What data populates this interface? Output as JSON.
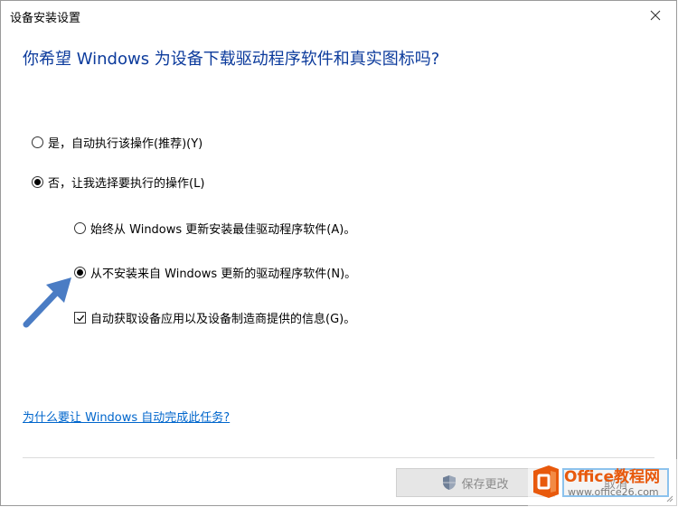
{
  "window": {
    "title": "设备安装设置"
  },
  "heading": "你希望 Windows 为设备下载驱动程序软件和真实图标吗?",
  "options": {
    "yes": {
      "label": "是，自动执行该操作(推荐)(Y)",
      "selected": false
    },
    "no": {
      "label": "否，让我选择要执行的操作(L)",
      "selected": true
    },
    "always": {
      "label": "始终从 Windows 更新安装最佳驱动程序软件(A)。",
      "selected": false
    },
    "never": {
      "label": "从不安装来自 Windows 更新的驱动程序软件(N)。",
      "selected": true
    },
    "auto_info": {
      "label": "自动获取设备应用以及设备制造商提供的信息(G)。",
      "checked": true
    }
  },
  "link": "为什么要让 Windows 自动完成此任务?",
  "buttons": {
    "save_label": "保存更改",
    "cancel_label": "取消"
  },
  "watermark": {
    "brand": "Office教程网",
    "url": "www.office26.com"
  },
  "colors": {
    "heading": "#0c3b9c",
    "link": "#0066cc",
    "accent_border": "#0078d7",
    "arrow": "#4a7cc4",
    "watermark_orange": "#e8590c"
  },
  "icons": {
    "close": "close-icon",
    "shield": "uac-shield-icon",
    "arrow": "pointer-arrow-icon",
    "checkmark": "checkmark-icon",
    "office_logo": "office-logo-icon"
  }
}
